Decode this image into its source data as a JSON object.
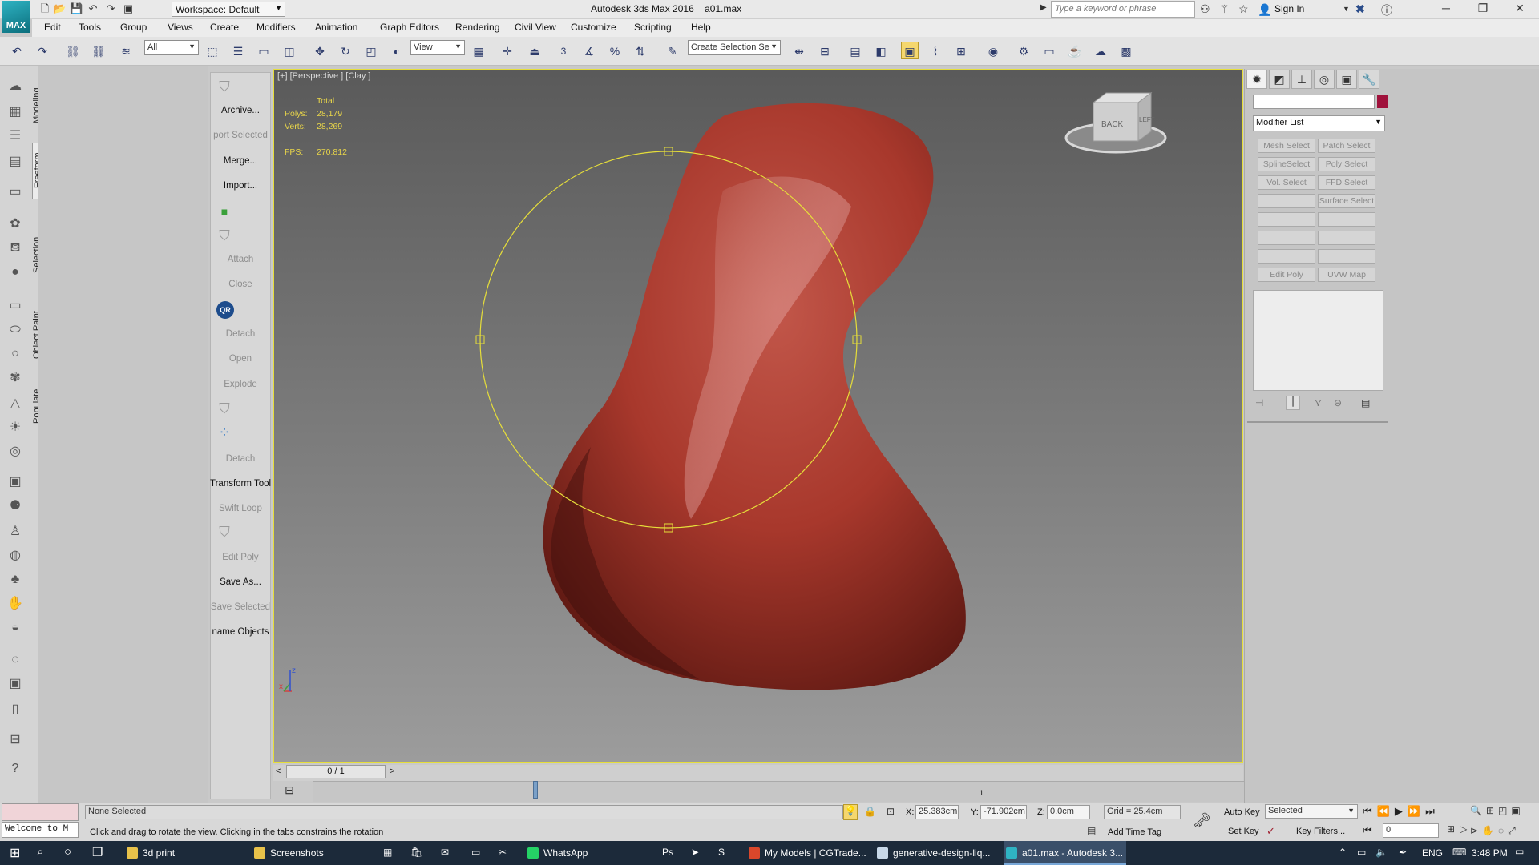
{
  "app": {
    "title": "Autodesk 3ds Max 2016",
    "file": "a01.max",
    "logo": "MAX",
    "workspace": "Workspace: Default",
    "search_placeholder": "Type a keyword or phrase",
    "sign_in": "Sign In"
  },
  "menus": [
    "Edit",
    "Tools",
    "Group",
    "Views",
    "Create",
    "Modifiers",
    "Animation",
    "Graph Editors",
    "Rendering",
    "Civil View",
    "Customize",
    "Scripting",
    "Help"
  ],
  "toolbar": {
    "filter": "All",
    "ref_coord": "View",
    "selection_set": "Create Selection Se",
    "snap_label": "3"
  },
  "left_tabs": [
    "Modeling",
    "Freeform",
    "Selection",
    "Object Paint",
    "Populate"
  ],
  "ribbon_panel": {
    "items": [
      {
        "label": "Archive...",
        "disabled": false
      },
      {
        "label": "port Selected",
        "disabled": true
      },
      {
        "label": "Merge...",
        "disabled": false
      },
      {
        "label": "Import...",
        "disabled": false
      },
      {
        "label": "Attach",
        "disabled": true
      },
      {
        "label": "Close",
        "disabled": true
      },
      {
        "label": "Detach",
        "disabled": true
      },
      {
        "label": "Open",
        "disabled": true
      },
      {
        "label": "Explode",
        "disabled": true
      },
      {
        "label": "Detach",
        "disabled": true
      },
      {
        "label": "Transform Tool",
        "disabled": false
      },
      {
        "label": "Swift Loop",
        "disabled": true
      },
      {
        "label": "Edit Poly",
        "disabled": true
      },
      {
        "label": "Save As...",
        "disabled": false
      },
      {
        "label": "Save Selected",
        "disabled": true
      },
      {
        "label": "name Objects",
        "disabled": false
      }
    ],
    "qr_badge": "QR"
  },
  "viewport": {
    "label": "[+] [Perspective ] [Clay ]",
    "stats": {
      "total_label": "Total",
      "polys_label": "Polys:",
      "polys": "28,179",
      "verts_label": "Verts:",
      "verts": "28,269",
      "fps_label": "FPS:",
      "fps": "270.812"
    },
    "viewcube": {
      "back": "BACK",
      "left": "LEFT"
    },
    "axis": {
      "x": "x",
      "z": "z"
    },
    "object_color": "#a8382c",
    "gizmo_color": "#e6de3a"
  },
  "command_panel": {
    "modifier_list": "Modifier List",
    "modifier_buttons": [
      [
        "Mesh Select",
        "Patch Select"
      ],
      [
        "SplineSelect",
        "Poly Select"
      ],
      [
        "Vol. Select",
        "FFD Select"
      ],
      [
        "",
        "Surface Select"
      ],
      [
        "",
        ""
      ],
      [
        "",
        ""
      ],
      [
        "",
        ""
      ],
      [
        "Edit Poly",
        "UVW Map"
      ]
    ],
    "swatch_color": "#a0123c"
  },
  "timeline": {
    "frame": "0 / 1",
    "prev": "<",
    "next": ">",
    "track_marker": "1"
  },
  "status": {
    "selection": "None Selected",
    "prompt": "Click and drag to rotate the view.  Clicking in the tabs constrains the rotation",
    "maxscript": "Welcome to M",
    "x_label": "X:",
    "x": "25.383cm",
    "y_label": "Y:",
    "y": "-71.902cm",
    "z_label": "Z:",
    "z": "0.0cm",
    "grid": "Grid = 25.4cm",
    "add_time_tag": "Add Time Tag",
    "auto_key": "Auto Key",
    "set_key": "Set Key",
    "key_mode": "Selected",
    "key_filters": "Key Filters...",
    "frame_field": "0"
  },
  "taskbar": {
    "items": [
      {
        "label": "3d print",
        "color": "#e8c24a",
        "active": false
      },
      {
        "label": "Screenshots",
        "color": "#e8c24a",
        "active": false
      },
      {
        "label": "WhatsApp",
        "color": "#25d366",
        "active": false
      },
      {
        "label": "My Models | CGTrade...",
        "color": "#d9472b",
        "active": false
      },
      {
        "label": "generative-design-liq...",
        "color": "#c8d8e8",
        "active": false
      },
      {
        "label": "a01.max - Autodesk 3...",
        "color": "#2fb3c3",
        "active": true
      }
    ],
    "lang": "ENG",
    "time": "3:48 PM"
  }
}
